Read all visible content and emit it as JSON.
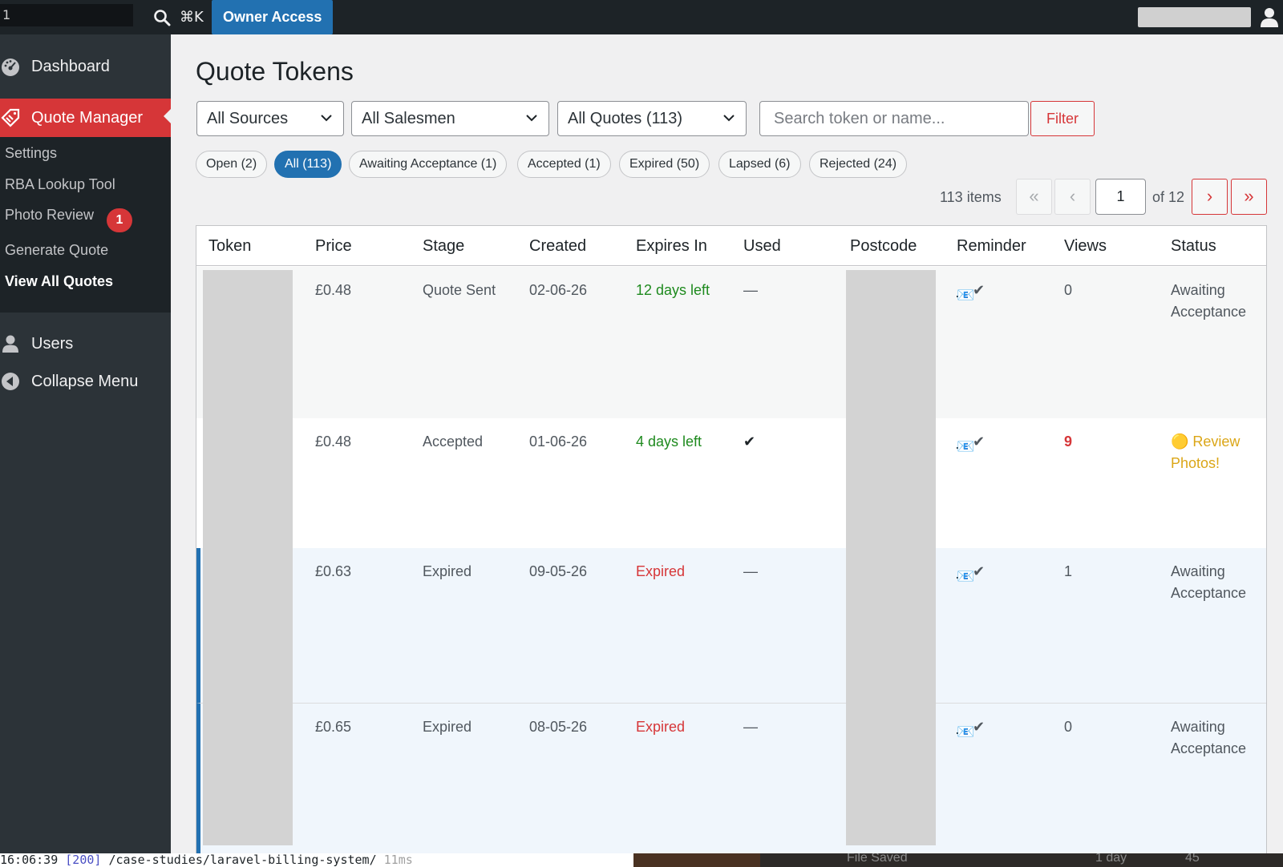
{
  "adminbar": {
    "logo_char": "1",
    "shortcut": "⌘K",
    "owner_label": "Owner Access"
  },
  "sidebar": {
    "dashboard": "Dashboard",
    "quote_manager": "Quote Manager",
    "submenu": [
      {
        "label": "Settings"
      },
      {
        "label": "RBA Lookup Tool"
      },
      {
        "label": "Photo Review",
        "badge": "1"
      },
      {
        "label": "Generate Quote"
      },
      {
        "label": "View All Quotes",
        "current": true
      }
    ],
    "users": "Users",
    "collapse": "Collapse Menu"
  },
  "page": {
    "title": "Quote Tokens"
  },
  "filters": {
    "sources": "All Sources",
    "salesmen": "All Salesmen",
    "quotes": "All Quotes (113)",
    "search_placeholder": "Search token or name...",
    "filter_button": "Filter"
  },
  "status_pills": [
    {
      "label": "Open (2)"
    },
    {
      "label": "All (113)",
      "active": true
    },
    {
      "label": "Awaiting Acceptance (1)"
    },
    {
      "label": "Accepted (1)"
    },
    {
      "label": "Expired (50)"
    },
    {
      "label": "Lapsed (6)"
    },
    {
      "label": "Rejected (24)"
    }
  ],
  "pagination": {
    "items": "113 items",
    "first": "«",
    "prev": "‹",
    "current_page": "1",
    "of_pages": "of 12",
    "next": "›",
    "last": "»"
  },
  "table": {
    "headers": [
      "Token",
      "Price",
      "Stage",
      "Created",
      "Expires In",
      "Used",
      "Postcode",
      "Reminder",
      "Views",
      "Status"
    ],
    "rows": [
      {
        "price": "£0.48",
        "stage": "Quote Sent",
        "created": "02-06-26",
        "expires": "12 days left",
        "used": "—",
        "reminder": "✔",
        "views": "0",
        "status_line1": "Awaiting",
        "status_line2": "Acceptance"
      },
      {
        "price": "£0.48",
        "stage": "Accepted",
        "created": "01-06-26",
        "expires": "4 days left",
        "used": "✔",
        "reminder": "✔",
        "views": "9",
        "status_line1": "🟡 Review",
        "status_line2": "Photos!"
      },
      {
        "price": "£0.63",
        "stage": "Expired",
        "created": "09-05-26",
        "expires": "Expired",
        "used": "—",
        "reminder": "✔",
        "views": "1",
        "status_line1": "Awaiting",
        "status_line2": "Acceptance"
      },
      {
        "price": "£0.65",
        "stage": "Expired",
        "created": "08-05-26",
        "expires": "Expired",
        "used": "—",
        "reminder": "✔",
        "views": "0",
        "status_line1": "Awaiting",
        "status_line2": "Acceptance"
      }
    ]
  },
  "footer": {
    "time": "16:06:39",
    "status": "[200]",
    "path": "/case-studies/laravel-billing-system/",
    "duration": "11ms",
    "right_status": "File Saved",
    "right_date": "1 day",
    "right_num": "45"
  },
  "colors": {
    "accent": "#d63638",
    "primary": "#2271b1",
    "sidebar": "#2c3338",
    "adminbar": "#1d2327"
  }
}
